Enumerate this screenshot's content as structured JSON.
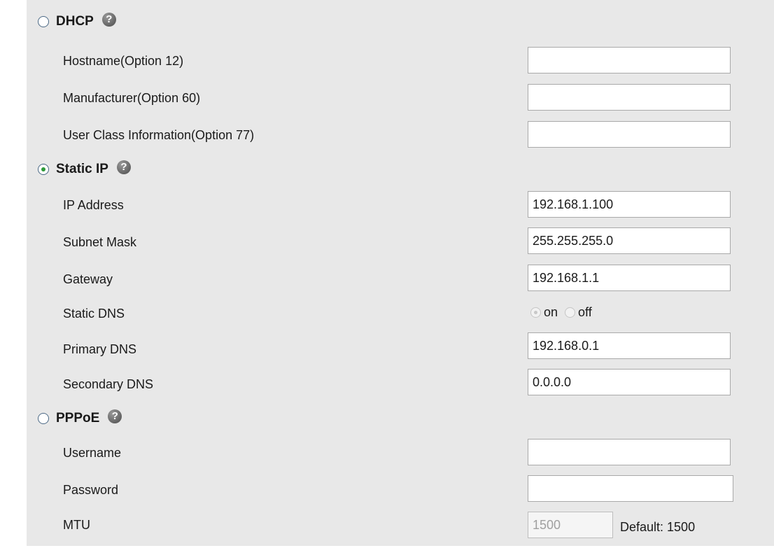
{
  "sections": {
    "dhcp": {
      "title": "DHCP",
      "selected": false,
      "help_icon": "question-circle-icon",
      "fields": [
        {
          "label": "Hostname(Option 12)",
          "value": ""
        },
        {
          "label": "Manufacturer(Option 60)",
          "value": ""
        },
        {
          "label": "User Class Information(Option 77)",
          "value": ""
        }
      ]
    },
    "static_ip": {
      "title": "Static IP",
      "selected": true,
      "help_icon": "question-circle-icon",
      "ip_address": {
        "label": "IP Address",
        "value": "192.168.1.100"
      },
      "subnet_mask": {
        "label": "Subnet Mask",
        "value": "255.255.255.0"
      },
      "gateway": {
        "label": "Gateway",
        "value": "192.168.1.1"
      },
      "static_dns": {
        "label": "Static DNS",
        "on_label": "on",
        "off_label": "off",
        "selected": "on"
      },
      "primary_dns": {
        "label": "Primary DNS",
        "value": "192.168.0.1"
      },
      "secondary_dns": {
        "label": "Secondary DNS",
        "value": "0.0.0.0"
      }
    },
    "pppoe": {
      "title": "PPPoE",
      "selected": false,
      "help_icon": "question-circle-icon",
      "username": {
        "label": "Username",
        "value": ""
      },
      "password": {
        "label": "Password",
        "value": ""
      },
      "mtu": {
        "label": "MTU",
        "value": "1500",
        "default_text": "Default: 1500"
      }
    }
  },
  "colors": {
    "panel_background": "#e8e8e8",
    "radio_selected": "#2e9a3a",
    "field_border": "#a9a9a9"
  }
}
